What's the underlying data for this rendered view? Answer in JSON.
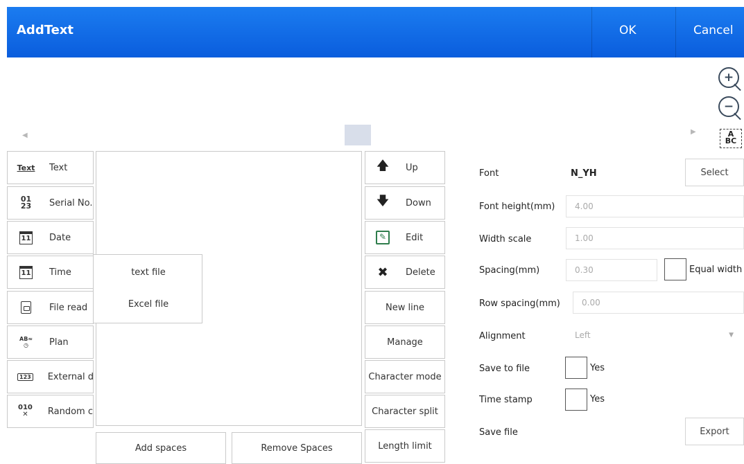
{
  "header": {
    "title": "AddText",
    "ok_label": "OK",
    "cancel_label": "Cancel"
  },
  "toolbar": {
    "zoom_in_glyph": "+",
    "zoom_out_glyph": "−",
    "abc_line1": "A",
    "abc_line2": "BC"
  },
  "left_menu": {
    "text": "Text",
    "serial": "Serial No.",
    "date": "Date",
    "time": "Time",
    "file_read": "File read",
    "plan": "Plan",
    "external": "External d",
    "random": "Random c"
  },
  "icons": {
    "text_icon": "Text",
    "serial_icon_top": "01",
    "serial_icon_bottom": "23",
    "calendar_day": "11",
    "plan_icon": "AB≈",
    "external_icon": "123",
    "random_icon": "010"
  },
  "file_popup": {
    "text_file": "text file",
    "excel_file": "Excel file"
  },
  "bottom_buttons": {
    "add_spaces": "Add spaces",
    "remove_spaces": "Remove Spaces",
    "length_limit": "Length limit"
  },
  "middle_buttons": {
    "up": "Up",
    "down": "Down",
    "edit": "Edit",
    "delete": "Delete",
    "new_line": "New line",
    "manage": "Manage",
    "character_mode": "Character mode",
    "character_split": "Character split"
  },
  "properties": {
    "font_label": "Font",
    "font_value": "N_YH",
    "select_label": "Select",
    "font_height_label": "Font height(mm)",
    "font_height_value": "4.00",
    "width_scale_label": "Width scale",
    "width_scale_value": "1.00",
    "spacing_label": "Spacing(mm)",
    "spacing_value": "0.30",
    "equal_width_label": "Equal width",
    "row_spacing_label": "Row spacing(mm)",
    "row_spacing_value": "0.00",
    "alignment_label": "Alignment",
    "alignment_value": "Left",
    "save_to_file_label": "Save to file",
    "save_to_file_yes": "Yes",
    "time_stamp_label": "Time stamp",
    "time_stamp_yes": "Yes",
    "save_file_label": "Save file",
    "export_label": "Export"
  },
  "colors": {
    "title_bar": "#0f6ae6",
    "accent_edit": "#2e7d4c",
    "preview_marker": "#d8deea"
  }
}
